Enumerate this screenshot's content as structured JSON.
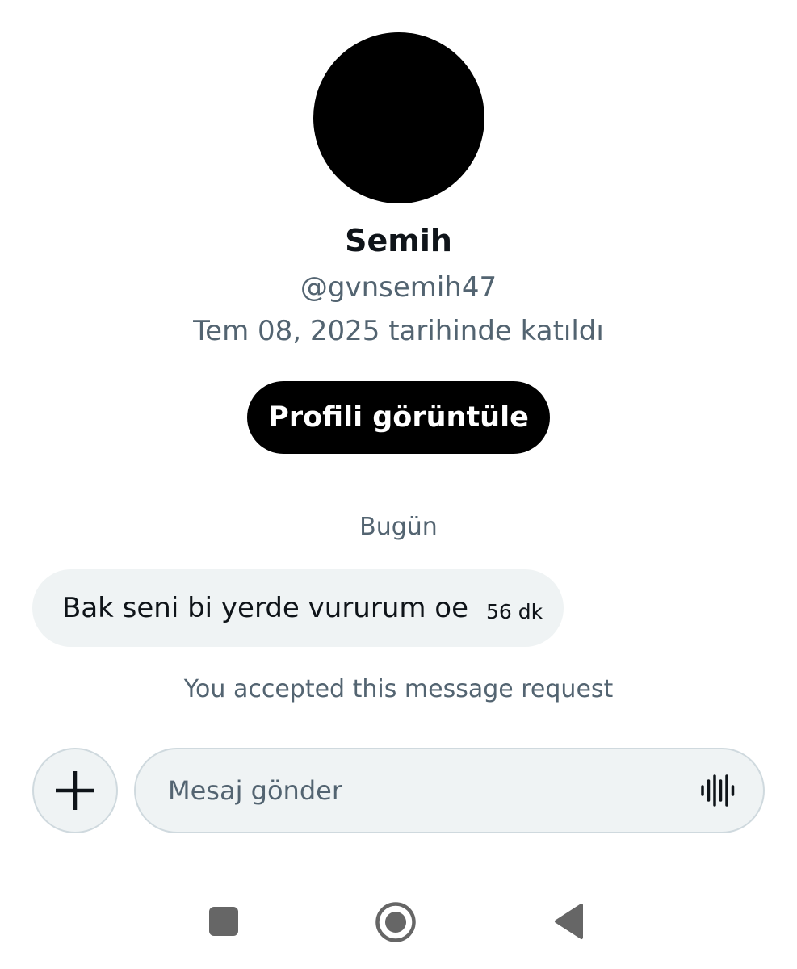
{
  "profile": {
    "display_name": "Semih",
    "handle": "@gvnsemih47",
    "joined": "Tem 08, 2025 tarihinde katıldı",
    "view_profile_label": "Profili görüntüle"
  },
  "conversation": {
    "date_separator": "Bugün",
    "messages": [
      {
        "text": "Bak seni bi yerde vururum oe",
        "time": "56 dk",
        "direction": "incoming"
      }
    ],
    "system_notice": "You accepted this message request"
  },
  "composer": {
    "placeholder": "Mesaj gönder",
    "value": "",
    "add_icon": "plus-icon",
    "voice_icon": "voice-waveform-icon"
  },
  "system_nav": {
    "icons": [
      "recents-square-icon",
      "home-circle-icon",
      "back-triangle-icon"
    ]
  },
  "colors": {
    "background": "#ffffff",
    "primary_text": "#0f1419",
    "secondary_text": "#536471",
    "bubble_background": "#eff3f4",
    "button_background": "#000000",
    "button_text": "#ffffff",
    "nav_icon": "#666666"
  }
}
